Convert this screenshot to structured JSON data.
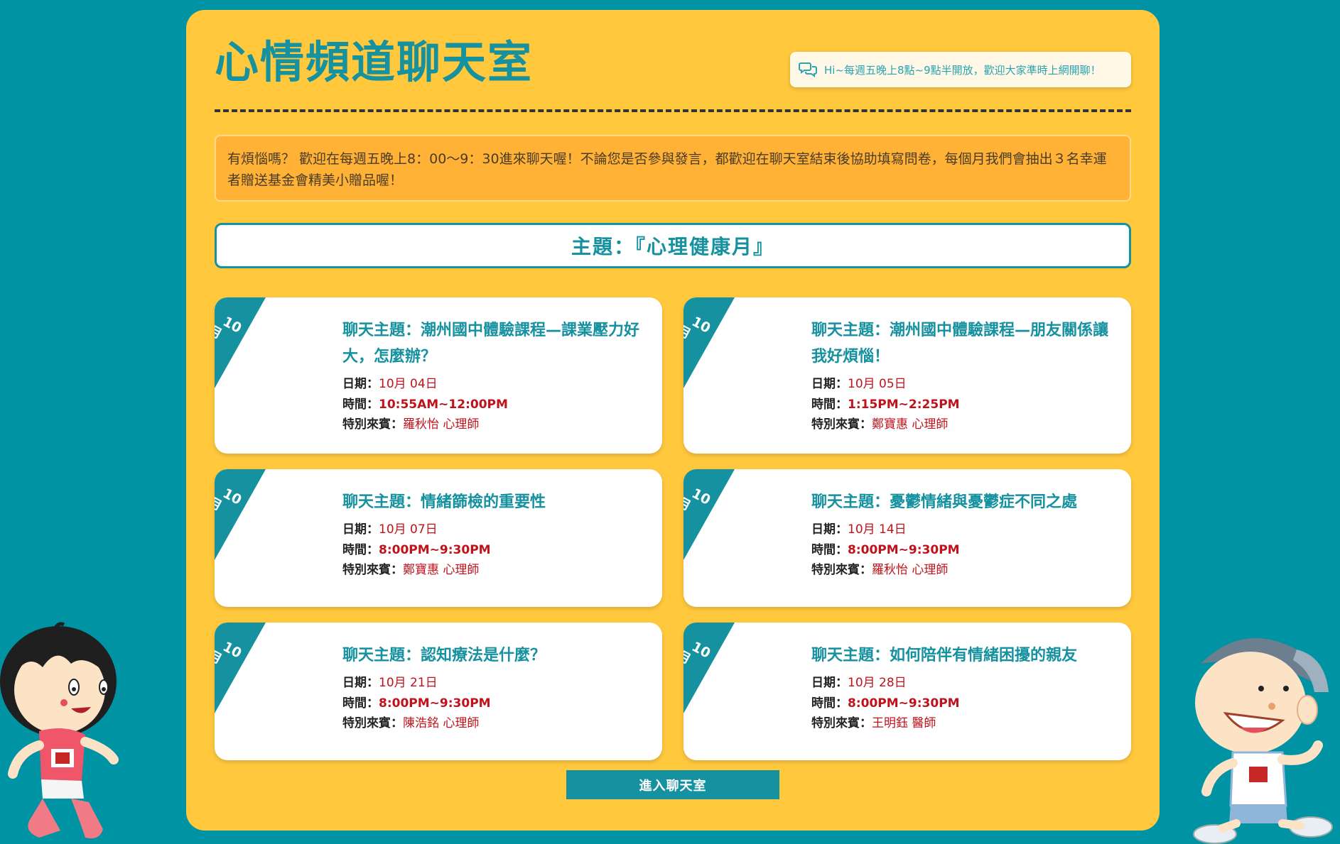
{
  "header": {
    "title": "心情頻道聊天室",
    "notice": "Hi~每週五晚上8點~9點半開放，歡迎大家準時上網開聊！"
  },
  "intro": {
    "text": "有煩惱嗎？ 歡迎在每週五晚上8：00～9：30進來聊天喔！不論您是否參與發言，都歡迎在聊天室結束後協助填寫問卷，每個月我們會抽出３名幸運者贈送基金會精美小贈品喔！"
  },
  "theme": {
    "text": "主題：『心理健康月』"
  },
  "labels": {
    "date": "日期：",
    "time": "時間：",
    "guest": "特別來賓："
  },
  "sessions": [
    {
      "month_num": "10",
      "month_unit": "月",
      "title": "聊天主題：潮州國中體驗課程—課業壓力好大，怎麼辦？",
      "date": "10月 04日",
      "time": "10:55AM~12:00PM",
      "guest": "羅秋怡 心理師"
    },
    {
      "month_num": "10",
      "month_unit": "月",
      "title": "聊天主題：潮州國中體驗課程—朋友關係讓我好煩惱！",
      "date": "10月 05日",
      "time": "1:15PM~2:25PM",
      "guest": "鄭寶惠 心理師"
    },
    {
      "month_num": "10",
      "month_unit": "月",
      "title": "聊天主題：情緒篩檢的重要性",
      "date": "10月 07日",
      "time": "8:00PM~9:30PM",
      "guest": "鄭寶惠 心理師"
    },
    {
      "month_num": "10",
      "month_unit": "月",
      "title": "聊天主題：憂鬱情緒與憂鬱症不同之處",
      "date": "10月 14日",
      "time": "8:00PM~9:30PM",
      "guest": "羅秋怡 心理師"
    },
    {
      "month_num": "10",
      "month_unit": "月",
      "title": "聊天主題：認知療法是什麼？",
      "date": "10月 21日",
      "time": "8:00PM~9:30PM",
      "guest": "陳浩銘 心理師"
    },
    {
      "month_num": "10",
      "month_unit": "月",
      "title": "聊天主題：如何陪伴有情緒困擾的親友",
      "date": "10月 28日",
      "time": "8:00PM~9:30PM",
      "guest": "王明鈺 醫師"
    }
  ],
  "actions": {
    "enter_label": "進入聊天室"
  },
  "colors": {
    "background": "#0093a3",
    "panel": "#ffc83d",
    "accent": "#15919f",
    "highlight_text": "#c0121b",
    "intro_box": "#ffb236"
  },
  "icons": {
    "notice": "chat-bubbles-icon"
  }
}
